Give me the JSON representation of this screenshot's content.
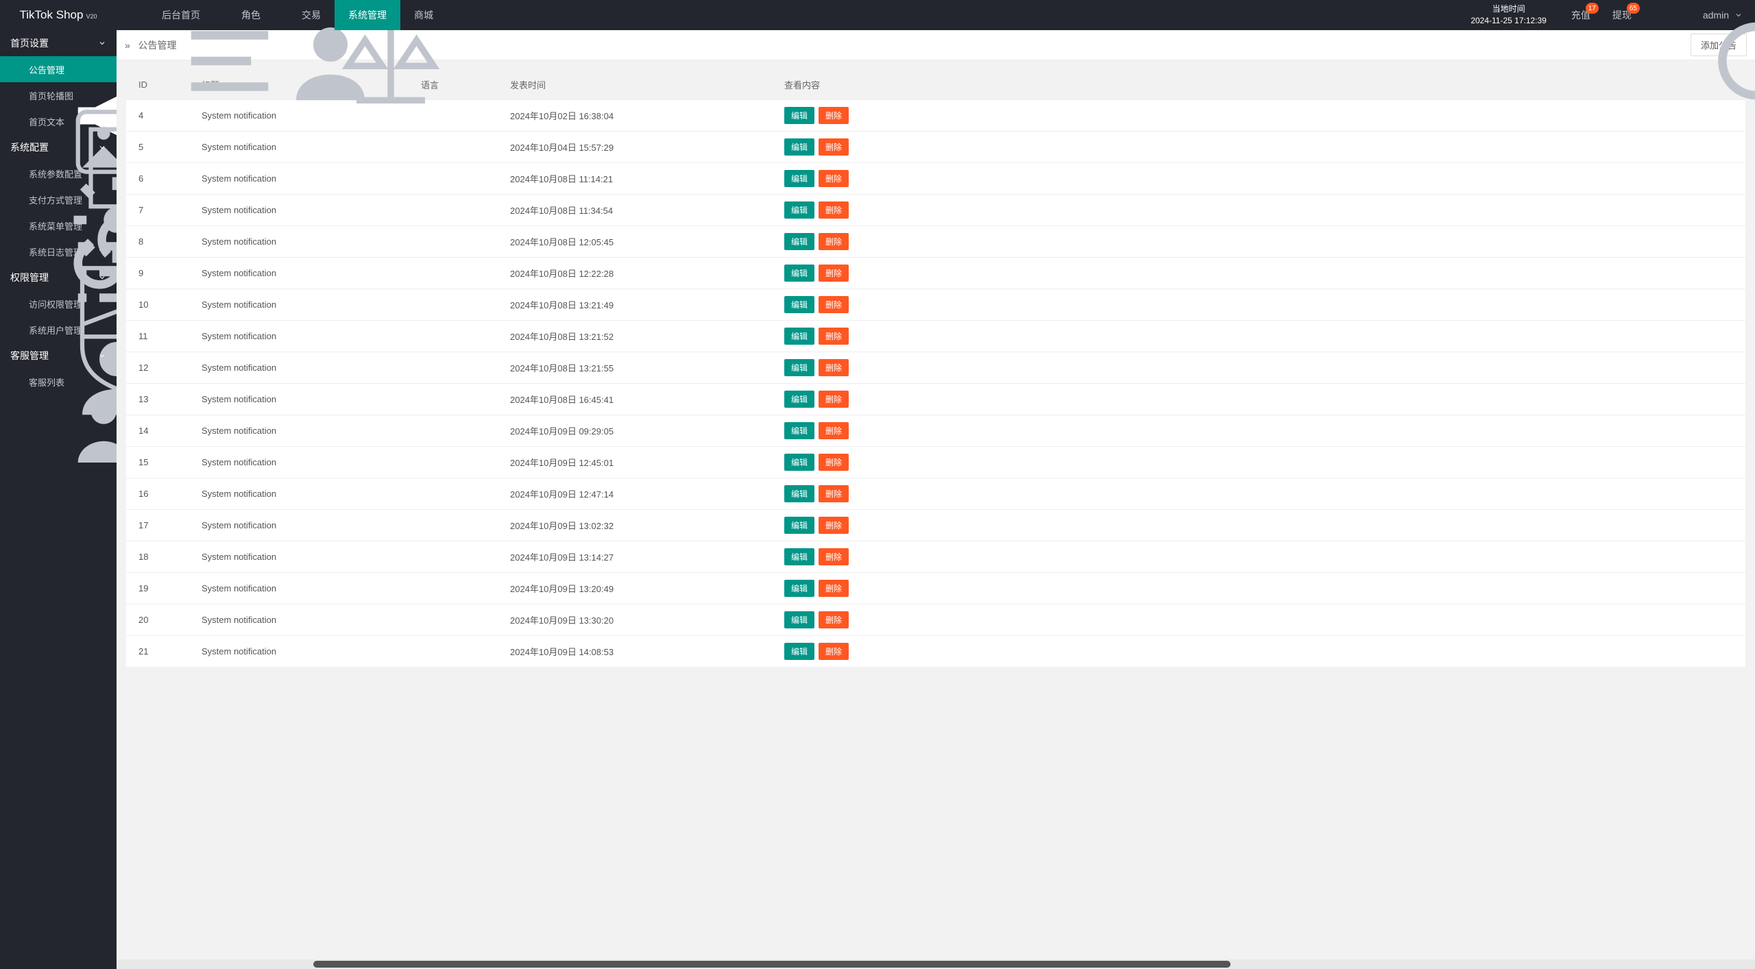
{
  "logo": {
    "name": "TikTok Shop",
    "ver": "V20"
  },
  "nav": [
    {
      "label": "后台首页",
      "icon": null
    },
    {
      "label": "角色",
      "icon": "user"
    },
    {
      "label": "交易",
      "icon": "scale"
    },
    {
      "label": "系统管理",
      "icon": null,
      "active": true
    },
    {
      "label": "商城",
      "icon": null
    }
  ],
  "header": {
    "time_title": "当地时间",
    "time_value": "2024-11-25 17:12:39",
    "recharge": "充值",
    "recharge_badge": "17",
    "withdraw": "提现",
    "withdraw_badge": "65",
    "user": "admin"
  },
  "sidebar": {
    "g1": "首页设置",
    "g1_items": [
      {
        "label": "公告管理",
        "icon": "megaphone",
        "active": true
      },
      {
        "label": "首页轮播图",
        "icon": "image"
      },
      {
        "label": "首页文本",
        "icon": "doc"
      }
    ],
    "g2": "系统配置",
    "g2_items": [
      {
        "label": "系统参数配置",
        "icon": "gear"
      },
      {
        "label": "支付方式管理",
        "icon": "link"
      },
      {
        "label": "系统菜单管理",
        "icon": "list"
      },
      {
        "label": "系统日志管理",
        "icon": "calendar"
      }
    ],
    "g3": "权限管理",
    "g3_items": [
      {
        "label": "访问权限管理",
        "icon": "shield"
      },
      {
        "label": "系统用户管理",
        "icon": "user"
      }
    ],
    "g4": "客服管理",
    "g4_items": [
      {
        "label": "客服列表",
        "icon": "users"
      }
    ]
  },
  "crumb": {
    "sep": "»",
    "title": "公告管理",
    "add": "添加公告"
  },
  "table": {
    "cols": {
      "id": "ID",
      "title": "标题",
      "lang": "语言",
      "time": "发表时间",
      "act": "查看内容"
    },
    "edit": "编辑",
    "del": "删除",
    "rows": [
      {
        "id": "4",
        "title": "System notification",
        "lang": "",
        "time": "2024年10月02日 16:38:04"
      },
      {
        "id": "5",
        "title": "System notification",
        "lang": "",
        "time": "2024年10月04日 15:57:29"
      },
      {
        "id": "6",
        "title": "System notification",
        "lang": "",
        "time": "2024年10月08日 11:14:21"
      },
      {
        "id": "7",
        "title": "System notification",
        "lang": "",
        "time": "2024年10月08日 11:34:54"
      },
      {
        "id": "8",
        "title": "System notification",
        "lang": "",
        "time": "2024年10月08日 12:05:45"
      },
      {
        "id": "9",
        "title": "System notification",
        "lang": "",
        "time": "2024年10月08日 12:22:28"
      },
      {
        "id": "10",
        "title": "System notification",
        "lang": "",
        "time": "2024年10月08日 13:21:49"
      },
      {
        "id": "11",
        "title": "System notification",
        "lang": "",
        "time": "2024年10月08日 13:21:52"
      },
      {
        "id": "12",
        "title": "System notification",
        "lang": "",
        "time": "2024年10月08日 13:21:55"
      },
      {
        "id": "13",
        "title": "System notification",
        "lang": "",
        "time": "2024年10月08日 16:45:41"
      },
      {
        "id": "14",
        "title": "System notification",
        "lang": "",
        "time": "2024年10月09日 09:29:05"
      },
      {
        "id": "15",
        "title": "System notification",
        "lang": "",
        "time": "2024年10月09日 12:45:01"
      },
      {
        "id": "16",
        "title": "System notification",
        "lang": "",
        "time": "2024年10月09日 12:47:14"
      },
      {
        "id": "17",
        "title": "System notification",
        "lang": "",
        "time": "2024年10月09日 13:02:32"
      },
      {
        "id": "18",
        "title": "System notification",
        "lang": "",
        "time": "2024年10月09日 13:14:27"
      },
      {
        "id": "19",
        "title": "System notification",
        "lang": "",
        "time": "2024年10月09日 13:20:49"
      },
      {
        "id": "20",
        "title": "System notification",
        "lang": "",
        "time": "2024年10月09日 13:30:20"
      },
      {
        "id": "21",
        "title": "System notification",
        "lang": "",
        "time": "2024年10月09日 14:08:53"
      }
    ]
  }
}
